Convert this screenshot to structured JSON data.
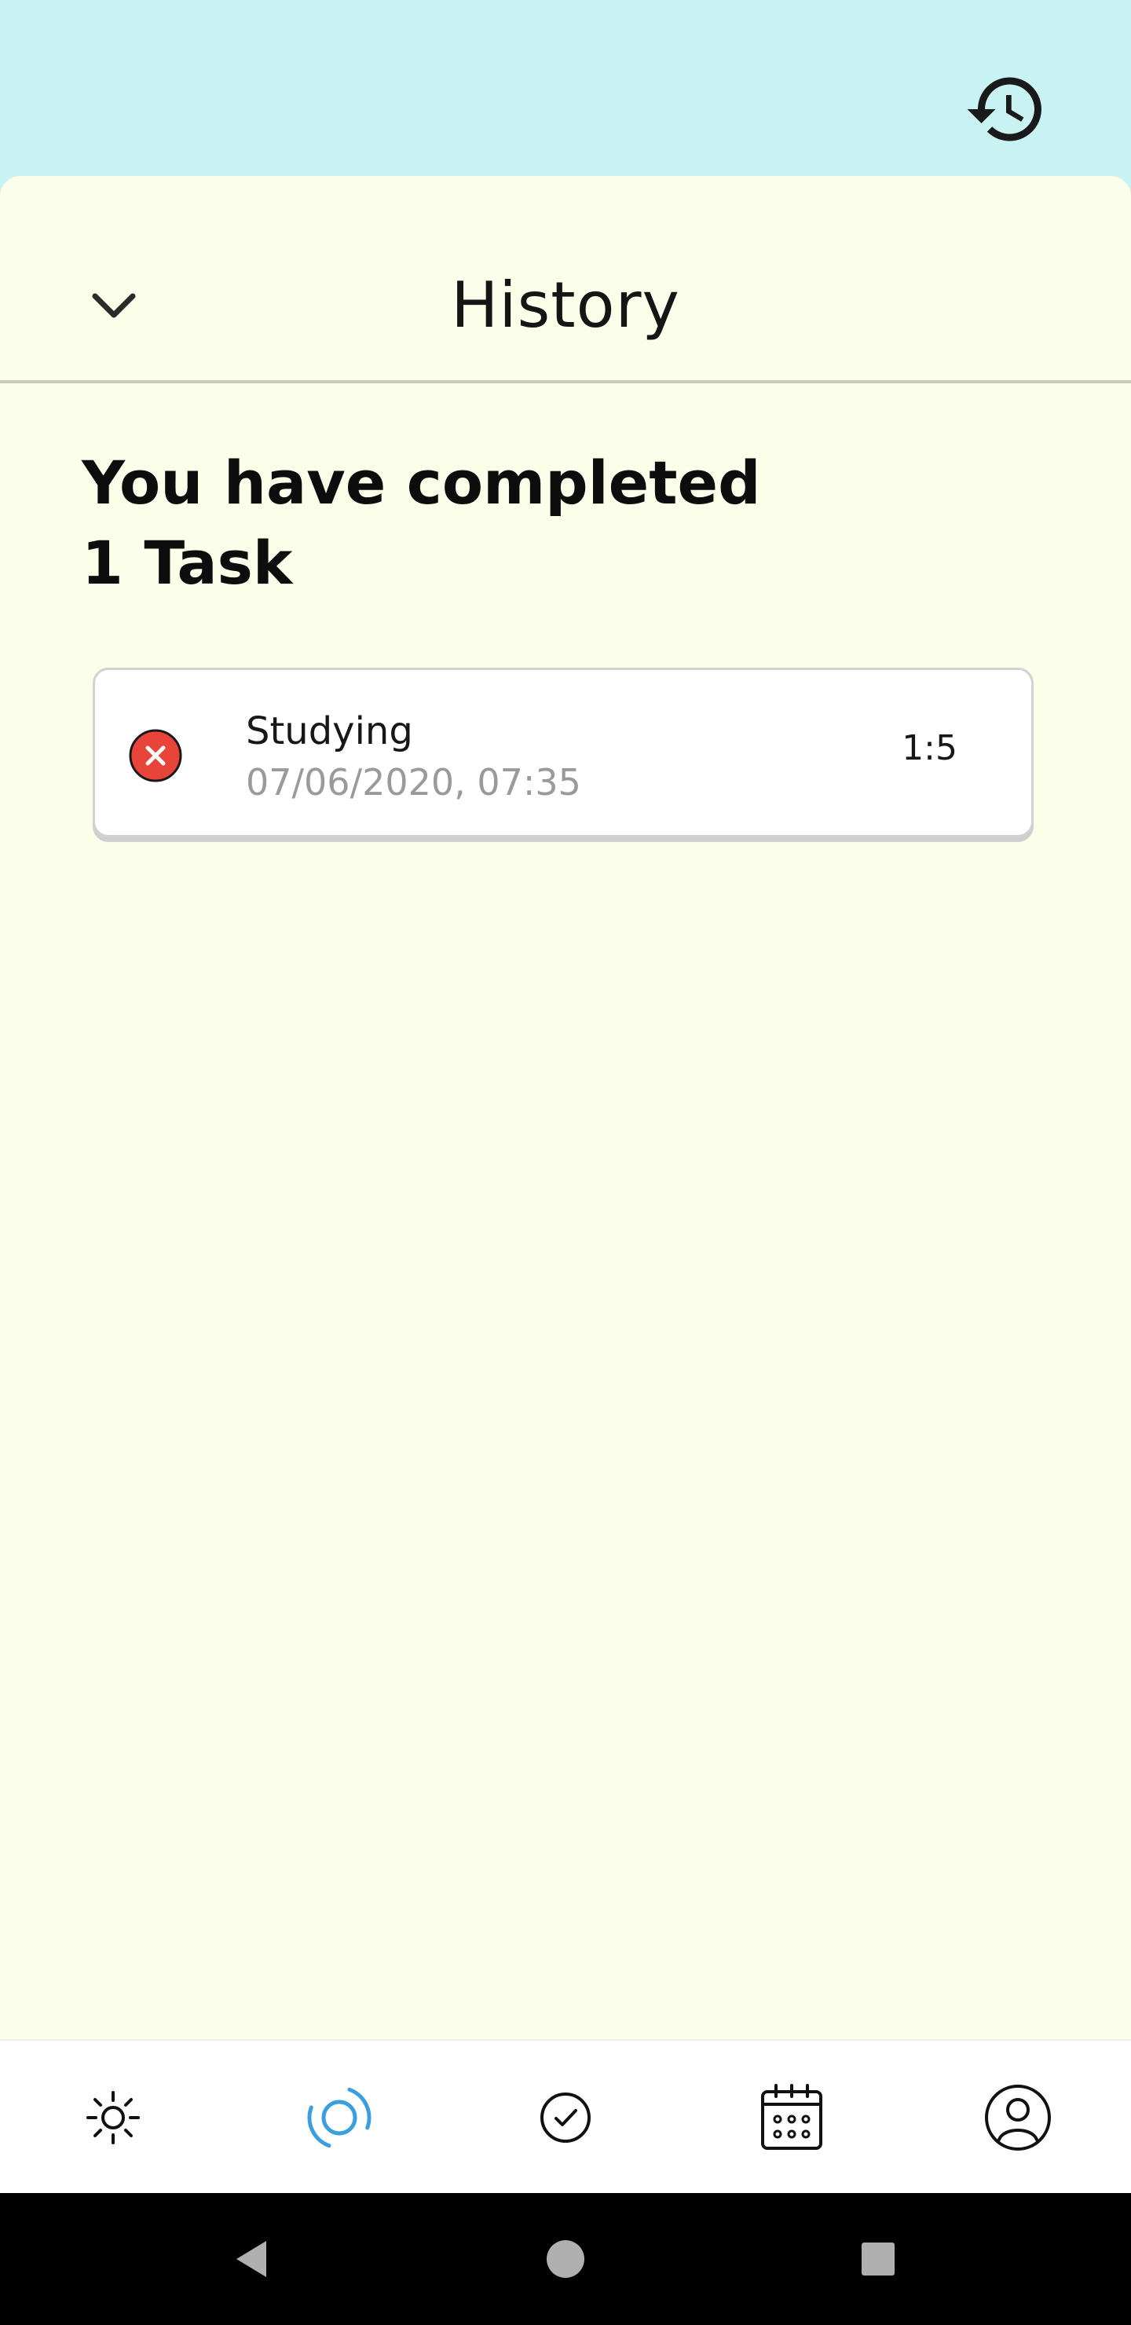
{
  "header": {
    "history_icon": "history-icon"
  },
  "sheet": {
    "title": "History",
    "collapse_icon": "chevron-down-icon",
    "summary_line1": "You have completed",
    "summary_line2": "1 Task"
  },
  "tasks": [
    {
      "name": "Studying",
      "date": "07/06/2020, 07:35",
      "duration": "1:5",
      "status": "failed",
      "status_icon": "close-circle-icon",
      "status_color": "#e8443a"
    }
  ],
  "bottom_nav": {
    "items": [
      {
        "icon": "sun-icon",
        "active": false
      },
      {
        "icon": "focus-target-icon",
        "active": true
      },
      {
        "icon": "check-circle-icon",
        "active": false
      },
      {
        "icon": "calendar-icon",
        "active": false
      },
      {
        "icon": "user-profile-icon",
        "active": false
      }
    ],
    "active_color": "#3a9ee0"
  },
  "system_nav": {
    "items": [
      "back-icon",
      "home-icon",
      "recents-icon"
    ]
  },
  "colors": {
    "top_background": "#c9f2f2",
    "sheet_background": "#fbfee8"
  }
}
